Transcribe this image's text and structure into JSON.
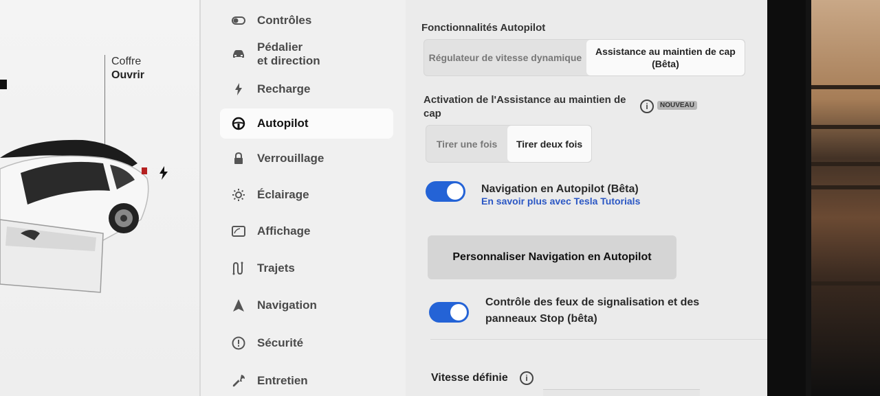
{
  "car": {
    "trunk_label": "Coffre",
    "trunk_action": "Ouvrir"
  },
  "menu": {
    "items": [
      {
        "label": "Contrôles",
        "icon": "toggle-icon",
        "selected": false
      },
      {
        "label": "Pédalier\net direction",
        "icon": "car-icon",
        "selected": false
      },
      {
        "label": "Recharge",
        "icon": "lightning-icon",
        "selected": false
      },
      {
        "label": "Autopilot",
        "icon": "steering-wheel-icon",
        "selected": true
      },
      {
        "label": "Verrouillage",
        "icon": "lock-icon",
        "selected": false
      },
      {
        "label": "Éclairage",
        "icon": "light-icon",
        "selected": false
      },
      {
        "label": "Affichage",
        "icon": "display-icon",
        "selected": false
      },
      {
        "label": "Trajets",
        "icon": "trips-icon",
        "selected": false
      },
      {
        "label": "Navigation",
        "icon": "navigation-icon",
        "selected": false
      },
      {
        "label": "Sécurité",
        "icon": "warning-icon",
        "selected": false
      },
      {
        "label": "Entretien",
        "icon": "wrench-icon",
        "selected": false
      }
    ]
  },
  "content": {
    "section_title": "Fonctionnalités Autopilot",
    "features": {
      "options": [
        "Régulateur de vitesse dynamique",
        "Assistance au maintien de cap (Bêta)"
      ],
      "selected": "Assistance au maintien de cap (Bêta)"
    },
    "activation": {
      "label": "Activation de l'Assistance au maintien de cap",
      "badge": "NOUVEAU",
      "options": [
        "Tirer une fois",
        "Tirer deux fois"
      ],
      "selected": "Tirer deux fois"
    },
    "nav_on_autopilot": {
      "label": "Navigation en Autopilot (Bêta)",
      "link": "En savoir plus avec Tesla Tutorials",
      "enabled": true
    },
    "customize_button": "Personnaliser Navigation en Autopilot",
    "traffic_control": {
      "label_line1": "Contrôle des feux de signalisation et des",
      "label_line2": "panneaux Stop (bêta)",
      "enabled": true
    },
    "speed_label": "Vitesse définie"
  },
  "colors": {
    "accent": "#2463d6",
    "link": "#2b57c4"
  }
}
